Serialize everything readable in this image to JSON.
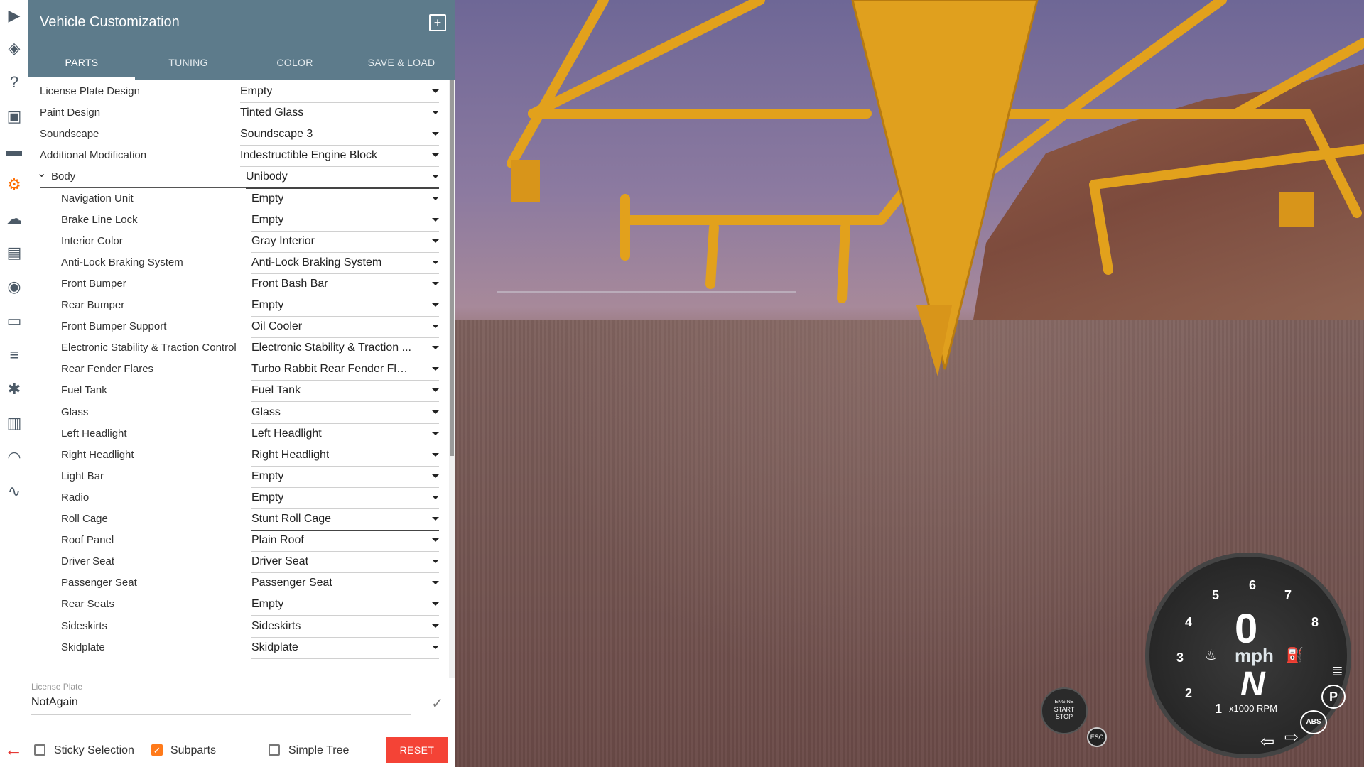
{
  "panel": {
    "title": "Vehicle Customization",
    "tabs": [
      "PARTS",
      "TUNING",
      "COLOR",
      "SAVE & LOAD"
    ],
    "active_tab": "PARTS"
  },
  "parts": [
    {
      "label": "License Plate Design",
      "value": "Empty",
      "indent": 0
    },
    {
      "label": "Paint Design",
      "value": "Tinted Glass",
      "indent": 0
    },
    {
      "label": "Soundscape",
      "value": "Soundscape 3",
      "indent": 0
    },
    {
      "label": "Additional Modification",
      "value": "Indestructible Engine Block",
      "indent": 0
    },
    {
      "label": "Body",
      "value": "Unibody",
      "indent": 0,
      "expandable": true
    },
    {
      "label": "Navigation Unit",
      "value": "Empty",
      "indent": 1
    },
    {
      "label": "Brake Line Lock",
      "value": "Empty",
      "indent": 1
    },
    {
      "label": "Interior Color",
      "value": "Gray Interior",
      "indent": 1
    },
    {
      "label": "Anti-Lock Braking System",
      "value": "Anti-Lock Braking System",
      "indent": 1
    },
    {
      "label": "Front Bumper",
      "value": "Front Bash Bar",
      "indent": 1
    },
    {
      "label": "Rear Bumper",
      "value": "Empty",
      "indent": 1
    },
    {
      "label": "Front Bumper Support",
      "value": "Oil Cooler",
      "indent": 1
    },
    {
      "label": "Electronic Stability & Traction Control",
      "value": "Electronic Stability & Traction ...",
      "indent": 1
    },
    {
      "label": "Rear Fender Flares",
      "value": "Turbo Rabbit Rear Fender Flar...",
      "indent": 1
    },
    {
      "label": "Fuel Tank",
      "value": "Fuel Tank",
      "indent": 1
    },
    {
      "label": "Glass",
      "value": "Glass",
      "indent": 1
    },
    {
      "label": "Left Headlight",
      "value": "Left Headlight",
      "indent": 1
    },
    {
      "label": "Right Headlight",
      "value": "Right Headlight",
      "indent": 1
    },
    {
      "label": "Light Bar",
      "value": "Empty",
      "indent": 1
    },
    {
      "label": "Radio",
      "value": "Empty",
      "indent": 1
    },
    {
      "label": "Roll Cage",
      "value": "Stunt Roll Cage",
      "indent": 1,
      "focused": true
    },
    {
      "label": "Roof Panel",
      "value": "Plain Roof",
      "indent": 1
    },
    {
      "label": "Driver Seat",
      "value": "Driver Seat",
      "indent": 1
    },
    {
      "label": "Passenger Seat",
      "value": "Passenger Seat",
      "indent": 1
    },
    {
      "label": "Rear Seats",
      "value": "Empty",
      "indent": 1
    },
    {
      "label": "Sideskirts",
      "value": "Sideskirts",
      "indent": 1
    },
    {
      "label": "Skidplate",
      "value": "Skidplate",
      "indent": 1
    }
  ],
  "license_plate": {
    "label": "License Plate",
    "value": "NotAgain"
  },
  "footer": {
    "sticky_selection": {
      "label": "Sticky Selection",
      "checked": false
    },
    "subparts": {
      "label": "Subparts",
      "checked": true
    },
    "simple_tree": {
      "label": "Simple Tree",
      "checked": false
    },
    "reset_label": "RESET"
  },
  "hud": {
    "speed": "0",
    "unit": "mph",
    "gear": "N",
    "rpm_label": "x1000 RPM",
    "rpm_ticks": [
      "1",
      "2",
      "3",
      "4",
      "5",
      "6",
      "7",
      "8"
    ],
    "engine_button": [
      "ENGINE",
      "START",
      "STOP"
    ],
    "esc_label": "ESC",
    "abs_label": "ABS",
    "park_label": "P"
  },
  "icons": [
    "play-icon",
    "layers-icon",
    "help-icon",
    "video-icon",
    "car-icon",
    "parts-icon",
    "cloud-icon",
    "film-icon",
    "camera-icon",
    "browser-icon",
    "sliders-icon",
    "bug-icon",
    "bar-chart-icon",
    "headphones-icon",
    "signature-icon",
    "back-arrow-icon"
  ],
  "colors": {
    "header": "#5d7b8b",
    "accent": "#ff6d00",
    "reset": "#f44336"
  }
}
